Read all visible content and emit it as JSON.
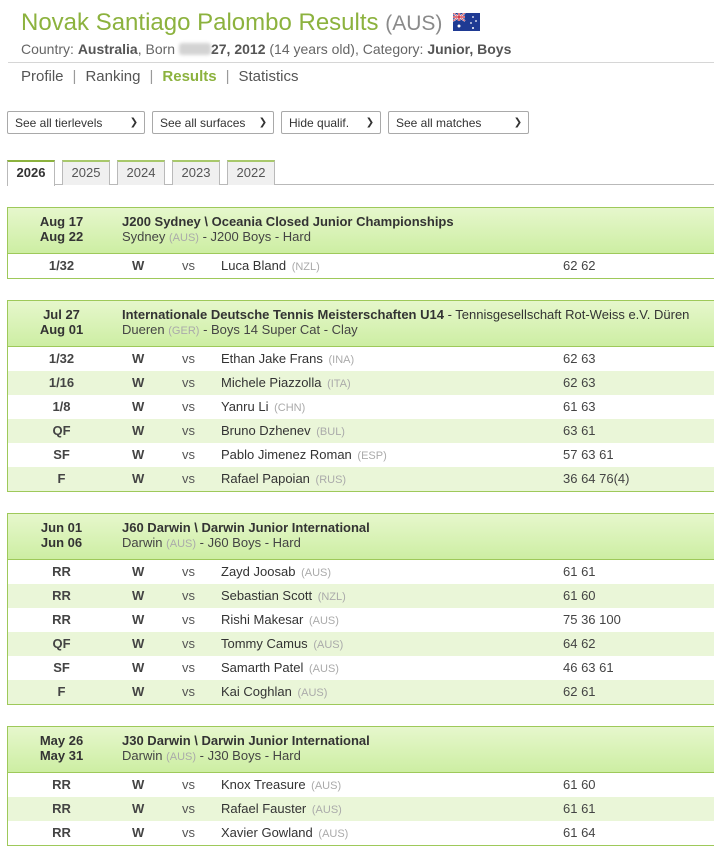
{
  "player": {
    "name": "Novak Santiago Palombo Results",
    "nationality": "(AUS)",
    "country_label": "Country:",
    "country": "Australia",
    "born_label": "Born",
    "born_date": "27, 2012",
    "age": "(14 years old),",
    "category_label": "Category:",
    "category": "Junior, Boys"
  },
  "nav": {
    "items": [
      "Profile",
      "Ranking",
      "Results",
      "Statistics"
    ],
    "active": "Results"
  },
  "filters": {
    "tierlevels": "See all tierlevels",
    "surfaces": "See all surfaces",
    "qualif": "Hide qualif.",
    "matches": "See all matches"
  },
  "years": {
    "tabs": [
      "2026",
      "2025",
      "2024",
      "2023",
      "2022"
    ],
    "active": "2026"
  },
  "tournaments": [
    {
      "date_start": "Aug 17",
      "date_end": "Aug 22",
      "name": "J200 Sydney \\ Oceania Closed Junior Championships",
      "name_extra": "",
      "city": "Sydney",
      "country": "(AUS)",
      "details": "- J200 Boys - Hard",
      "matches": [
        {
          "round": "1/32",
          "result": "W",
          "vs": "vs",
          "opponent": "Luca Bland",
          "opp_country": "(NZL)",
          "score": "62 62"
        }
      ]
    },
    {
      "date_start": "Jul 27",
      "date_end": "Aug 01",
      "name": "Internationale Deutsche Tennis Meisterschaften U14",
      "name_extra": " - Tennisgesellschaft Rot-Weiss e.V. Düren",
      "city": "Dueren",
      "country": "(GER)",
      "details": "- Boys 14 Super Cat - Clay",
      "matches": [
        {
          "round": "1/32",
          "result": "W",
          "vs": "vs",
          "opponent": "Ethan Jake Frans",
          "opp_country": "(INA)",
          "score": "62 63"
        },
        {
          "round": "1/16",
          "result": "W",
          "vs": "vs",
          "opponent": "Michele Piazzolla",
          "opp_country": "(ITA)",
          "score": "62 63"
        },
        {
          "round": "1/8",
          "result": "W",
          "vs": "vs",
          "opponent": "Yanru Li",
          "opp_country": "(CHN)",
          "score": "61 63"
        },
        {
          "round": "QF",
          "result": "W",
          "vs": "vs",
          "opponent": "Bruno Dzhenev",
          "opp_country": "(BUL)",
          "score": "63 61"
        },
        {
          "round": "SF",
          "result": "W",
          "vs": "vs",
          "opponent": "Pablo Jimenez Roman",
          "opp_country": "(ESP)",
          "score": "57 63 61"
        },
        {
          "round": "F",
          "result": "W",
          "vs": "vs",
          "opponent": "Rafael Papoian",
          "opp_country": "(RUS)",
          "score": "36 64 76(4)"
        }
      ]
    },
    {
      "date_start": "Jun 01",
      "date_end": "Jun 06",
      "name": "J60 Darwin \\ Darwin Junior International",
      "name_extra": "",
      "city": "Darwin",
      "country": "(AUS)",
      "details": "- J60 Boys - Hard",
      "matches": [
        {
          "round": "RR",
          "result": "W",
          "vs": "vs",
          "opponent": "Zayd Joosab",
          "opp_country": "(AUS)",
          "score": "61 61"
        },
        {
          "round": "RR",
          "result": "W",
          "vs": "vs",
          "opponent": "Sebastian Scott",
          "opp_country": "(NZL)",
          "score": "61 60"
        },
        {
          "round": "RR",
          "result": "W",
          "vs": "vs",
          "opponent": "Rishi Makesar",
          "opp_country": "(AUS)",
          "score": "75 36 100"
        },
        {
          "round": "QF",
          "result": "W",
          "vs": "vs",
          "opponent": "Tommy Camus",
          "opp_country": "(AUS)",
          "score": "64 62"
        },
        {
          "round": "SF",
          "result": "W",
          "vs": "vs",
          "opponent": "Samarth Patel",
          "opp_country": "(AUS)",
          "score": "46 63 61"
        },
        {
          "round": "F",
          "result": "W",
          "vs": "vs",
          "opponent": "Kai Coghlan",
          "opp_country": "(AUS)",
          "score": "62 61"
        }
      ]
    },
    {
      "date_start": "May 26",
      "date_end": "May 31",
      "name": "J30 Darwin \\ Darwin Junior International",
      "name_extra": "",
      "city": "Darwin",
      "country": "(AUS)",
      "details": "- J30 Boys - Hard",
      "matches": [
        {
          "round": "RR",
          "result": "W",
          "vs": "vs",
          "opponent": "Knox Treasure",
          "opp_country": "(AUS)",
          "score": "61 60"
        },
        {
          "round": "RR",
          "result": "W",
          "vs": "vs",
          "opponent": "Rafael Fauster",
          "opp_country": "(AUS)",
          "score": "61 61"
        },
        {
          "round": "RR",
          "result": "W",
          "vs": "vs",
          "opponent": "Xavier Gowland",
          "opp_country": "(AUS)",
          "score": "61 64"
        }
      ]
    }
  ],
  "colors": {
    "accent": "#8cb23e",
    "header_gradient_top": "#e6f7cc",
    "header_gradient_bottom": "#cdeea3",
    "alt_row": "#eaf6d8",
    "border": "#9ec95a"
  }
}
